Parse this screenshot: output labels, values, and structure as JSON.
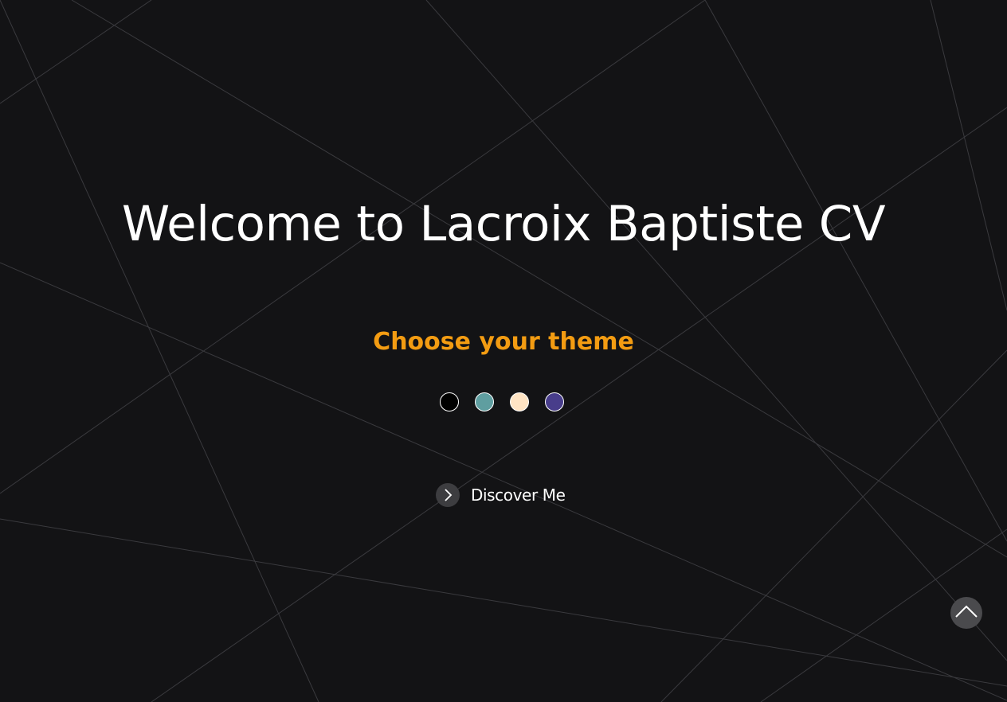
{
  "hero": {
    "title": "Welcome to Lacroix Baptiste CV",
    "subtitle": "Choose your theme",
    "subtitle_color": "#f39c12"
  },
  "themes": [
    {
      "name": "dark",
      "color": "#000000"
    },
    {
      "name": "teal",
      "color": "#5f9ea0"
    },
    {
      "name": "cream",
      "color": "#ffe4c4"
    },
    {
      "name": "purple",
      "color": "#483d8b"
    }
  ],
  "discover": {
    "label": "Discover Me",
    "icon": "chevron-right-icon"
  },
  "scroll_top": {
    "icon": "chevron-up-icon"
  },
  "colors": {
    "background": "#131315",
    "text": "#ffffff"
  }
}
